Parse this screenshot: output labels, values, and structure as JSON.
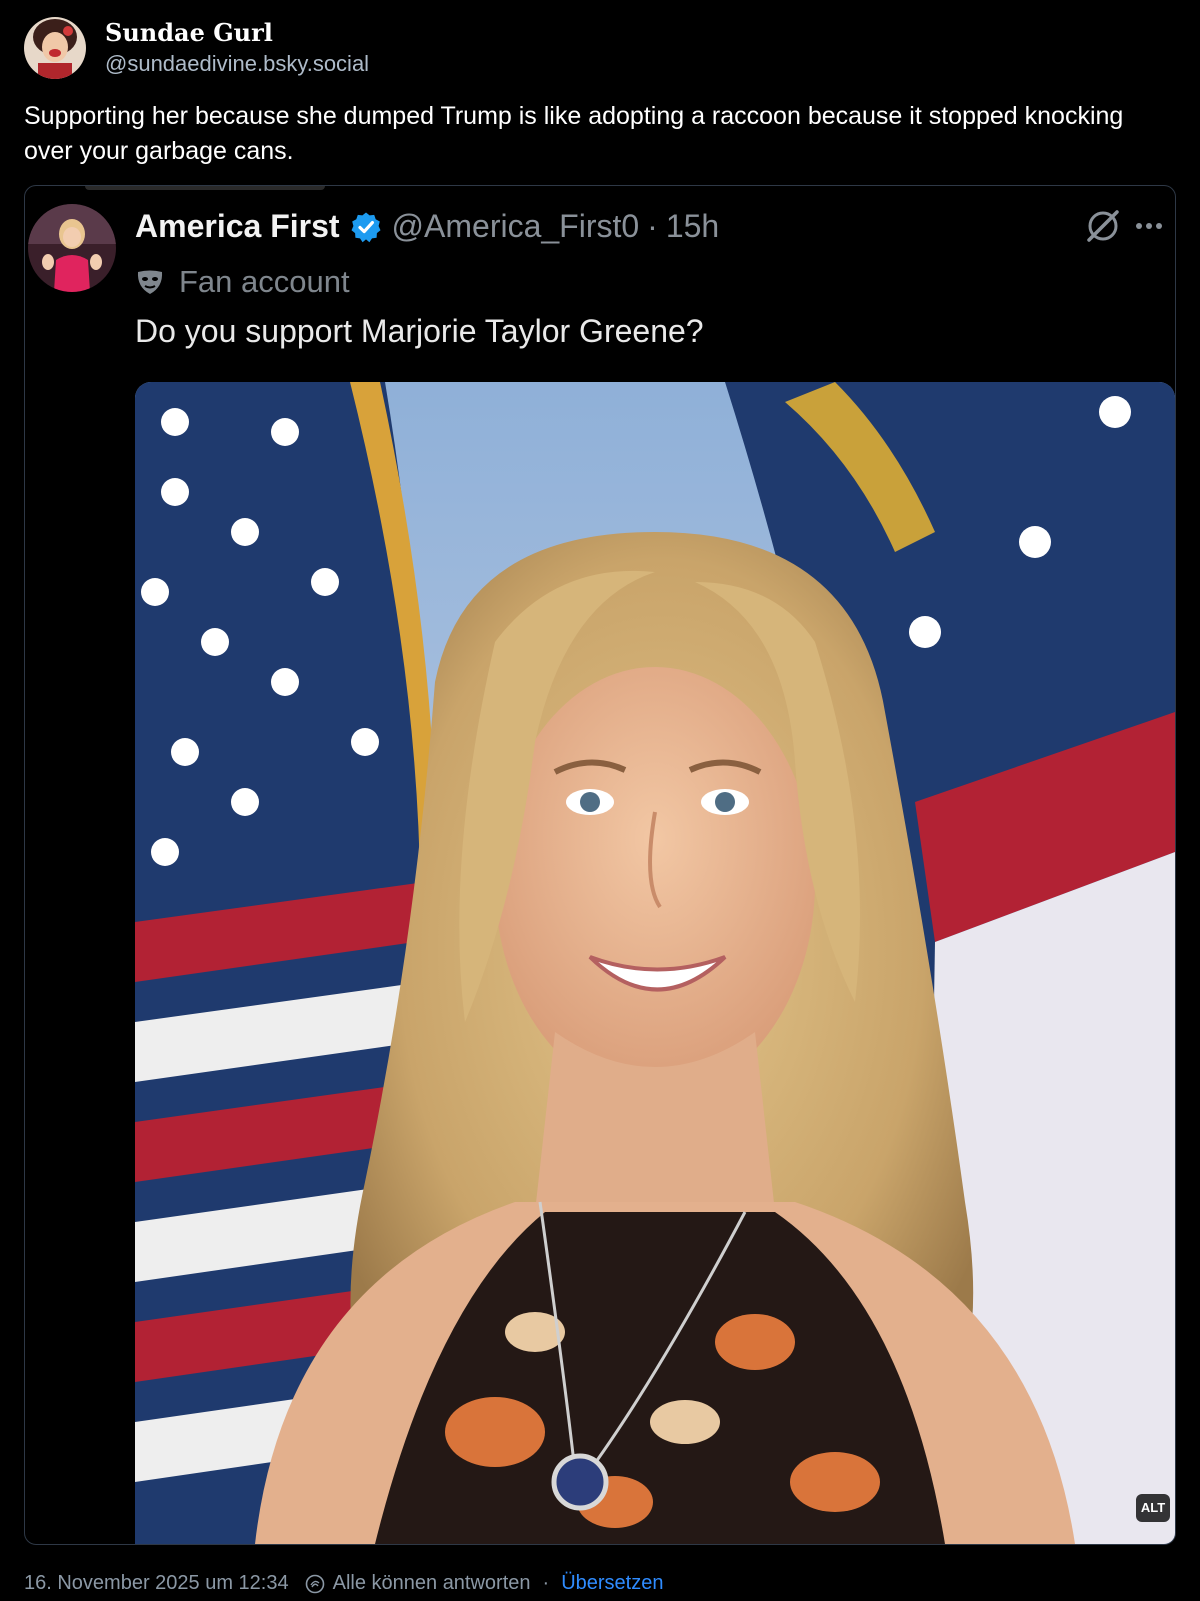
{
  "post": {
    "author": {
      "display_name": "Sundae Gurl",
      "handle": "@sundaedivine.bsky.social"
    },
    "text": "Supporting her because she dumped Trump is like adopting a raccoon because it stopped knocking over your garbage cans."
  },
  "quoted_post": {
    "author": {
      "name": "America First",
      "handle": "@America_First0",
      "time": "15h",
      "separator": "·",
      "verified_icon": "verified-badge-icon",
      "label": "Fan account"
    },
    "text": "Do you support Marjorie Taylor Greene?",
    "image": {
      "alt_badge": "ALT"
    },
    "icons": [
      "grok-icon",
      "more-icon",
      "mask-icon"
    ]
  },
  "footer": {
    "timestamp": "16. November 2025 um 12:34",
    "reply_setting": "Alle können antworten",
    "separator": "·",
    "translate_label": "Übersetzen"
  },
  "colors": {
    "background": "#000000",
    "verified_blue": "#1d9bf0",
    "link_blue": "#2f8cff",
    "muted_text": "#8b98a5"
  }
}
